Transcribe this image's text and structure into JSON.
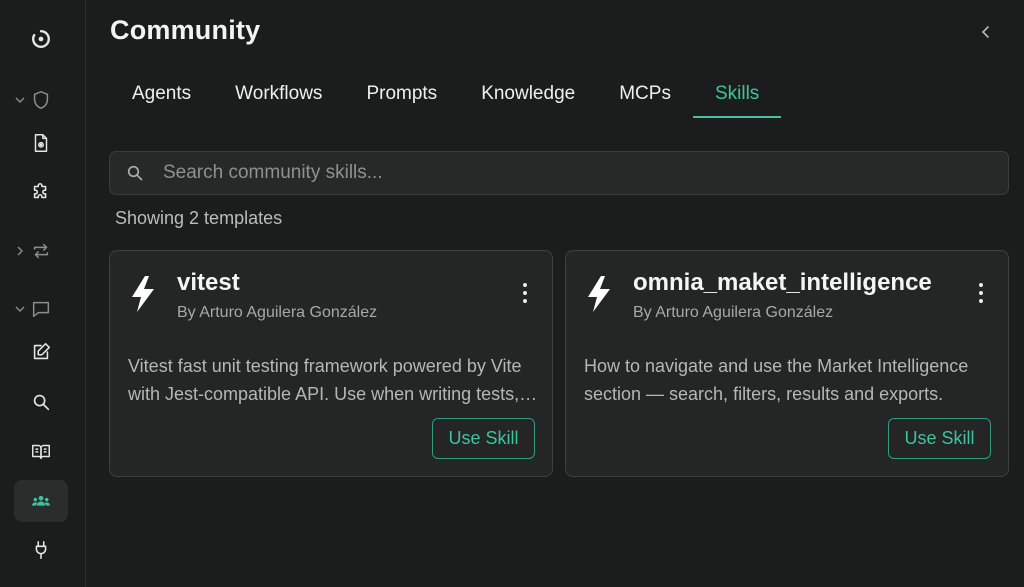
{
  "page_title": "Community",
  "tabs": [
    {
      "label": "Agents"
    },
    {
      "label": "Workflows"
    },
    {
      "label": "Prompts"
    },
    {
      "label": "Knowledge"
    },
    {
      "label": "MCPs"
    },
    {
      "label": "Skills",
      "active": true
    }
  ],
  "search": {
    "placeholder": "Search community skills...",
    "value": ""
  },
  "count_text": "Showing 2 templates",
  "cards": [
    {
      "title": "vitest",
      "author": "By Arturo Aguilera González",
      "description": "Vitest fast unit testing framework powered by Vite with Jest-compatible API. Use when writing tests, mocking, configuring coverage, or working with test filtering and fixtures.",
      "button_label": "Use Skill",
      "icon": "bolt-icon"
    },
    {
      "title": "omnia_maket_intelligence",
      "author": "By Arturo Aguilera González",
      "description": "How to navigate and use the Market Intelligence section — search, filters, results and exports.",
      "button_label": "Use Skill",
      "icon": "bolt-icon"
    }
  ],
  "sidebar": {
    "icons": [
      "logo-icon",
      "shield-icon",
      "document-gear-icon",
      "puzzle-icon",
      "repeat-icon",
      "chat-icon",
      "edit-icon",
      "search-icon",
      "book-icon",
      "community-icon",
      "plug-icon"
    ],
    "active": "community-icon"
  },
  "colors": {
    "accent": "#3fc39b",
    "background": "#1b1d1c",
    "card_background": "#232624",
    "card_border": "#3d413e"
  }
}
